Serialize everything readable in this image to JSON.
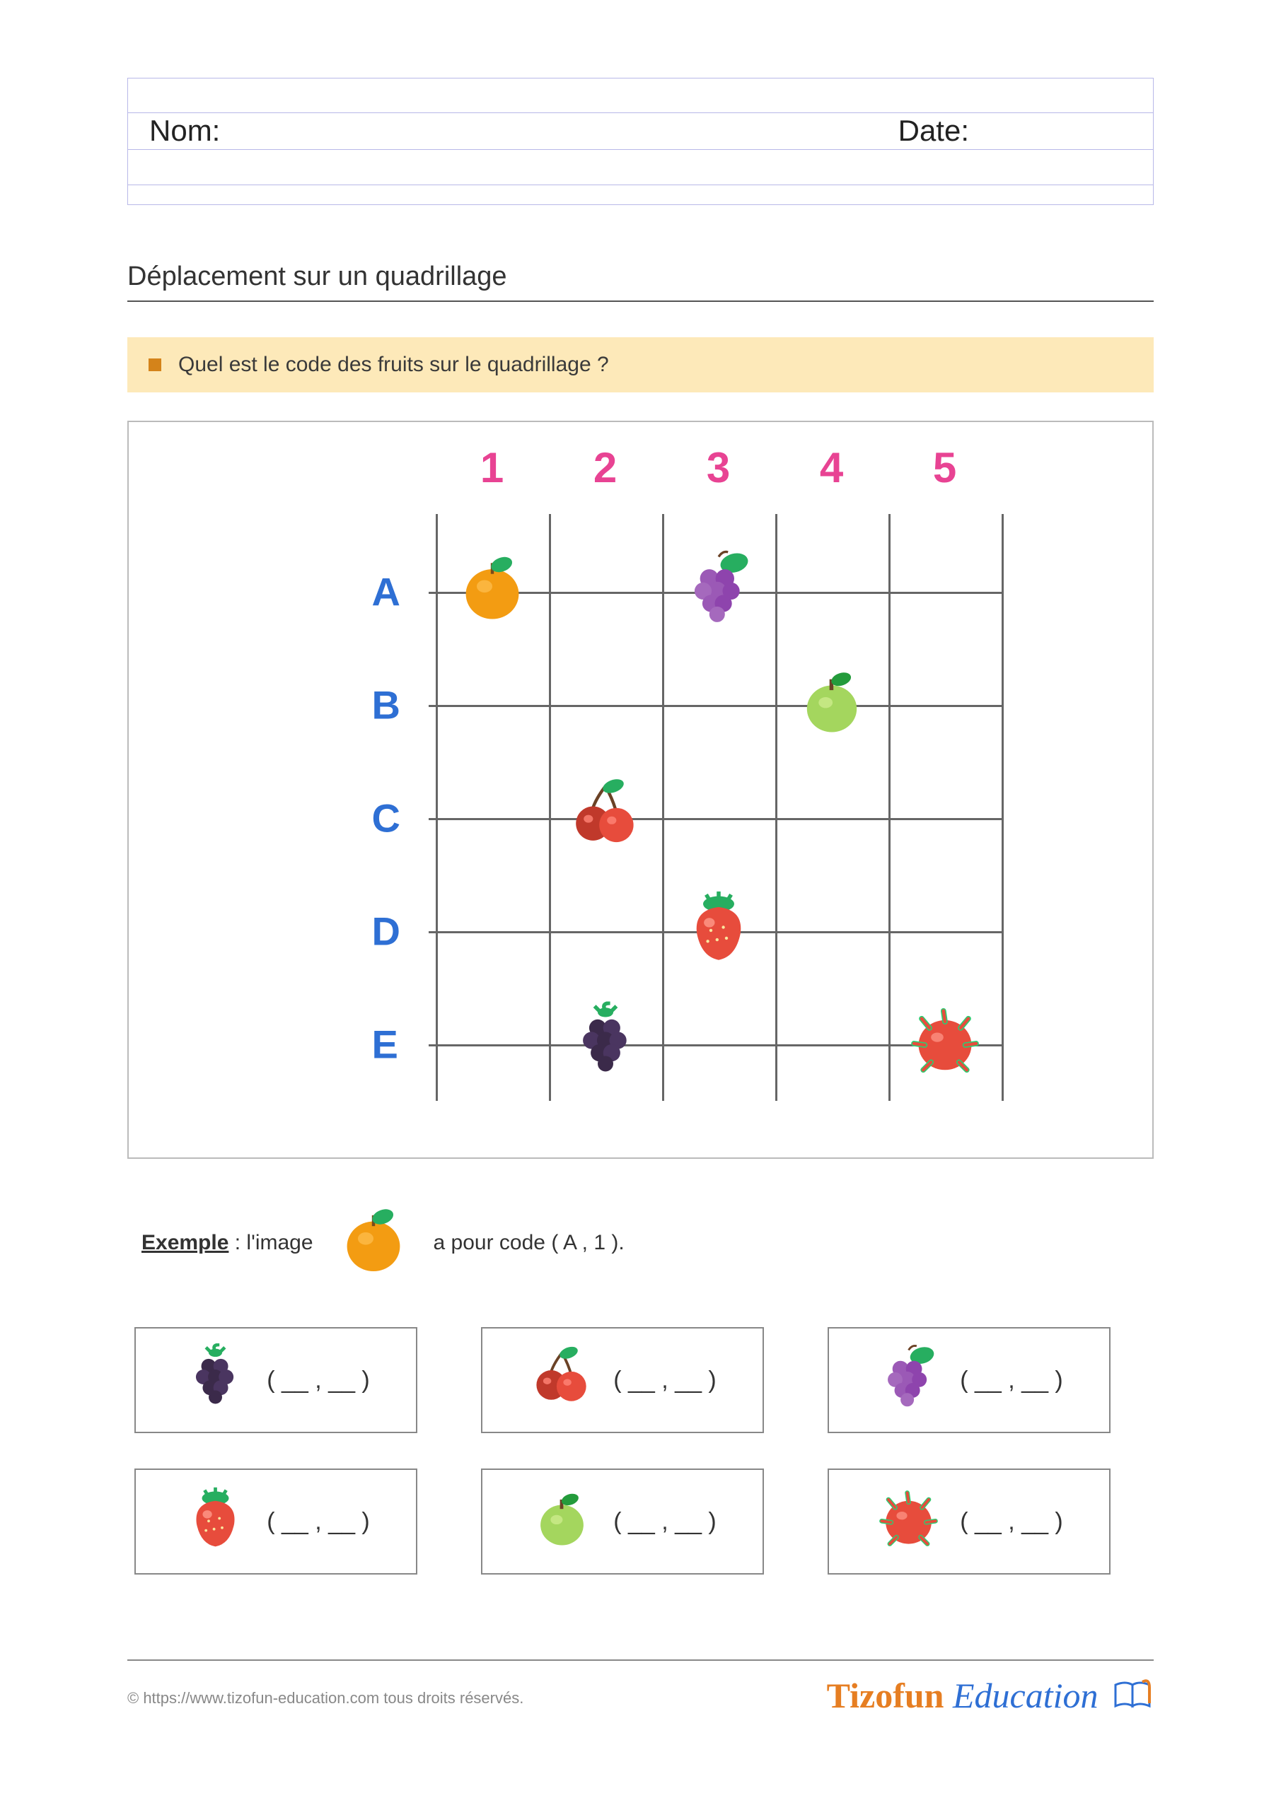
{
  "header": {
    "name_label": "Nom:",
    "date_label": "Date:"
  },
  "section_title": "Déplacement sur un quadrillage",
  "question": "Quel est le code des fruits sur le quadrillage ?",
  "columns": [
    "1",
    "2",
    "3",
    "4",
    "5"
  ],
  "rows": [
    "A",
    "B",
    "C",
    "D",
    "E"
  ],
  "grid_fruits": [
    {
      "fruit": "orange",
      "row": "A",
      "col": "1"
    },
    {
      "fruit": "grapes",
      "row": "A",
      "col": "3"
    },
    {
      "fruit": "guava",
      "row": "B",
      "col": "4"
    },
    {
      "fruit": "cherries",
      "row": "C",
      "col": "2"
    },
    {
      "fruit": "strawberry",
      "row": "D",
      "col": "3"
    },
    {
      "fruit": "blackberry",
      "row": "E",
      "col": "2"
    },
    {
      "fruit": "dragonfruit",
      "row": "E",
      "col": "5"
    }
  ],
  "example": {
    "label": "Exemple",
    "text_before": ": l'image",
    "fruit": "orange",
    "text_after": "a pour code (  A  ,  1  )."
  },
  "answers": [
    {
      "fruit": "blackberry",
      "blank": "( __ , __ )"
    },
    {
      "fruit": "cherries",
      "blank": "( __ , __ )"
    },
    {
      "fruit": "grapes",
      "blank": "( __ , __ )"
    },
    {
      "fruit": "strawberry",
      "blank": "( __ , __ )"
    },
    {
      "fruit": "guava",
      "blank": "( __ , __ )"
    },
    {
      "fruit": "dragonfruit",
      "blank": "( __ , __ )"
    }
  ],
  "footer": {
    "copyright": "© https://www.tizofun-education.com tous droits réservés.",
    "brand1": "Tizofun",
    "brand2": "Education"
  }
}
